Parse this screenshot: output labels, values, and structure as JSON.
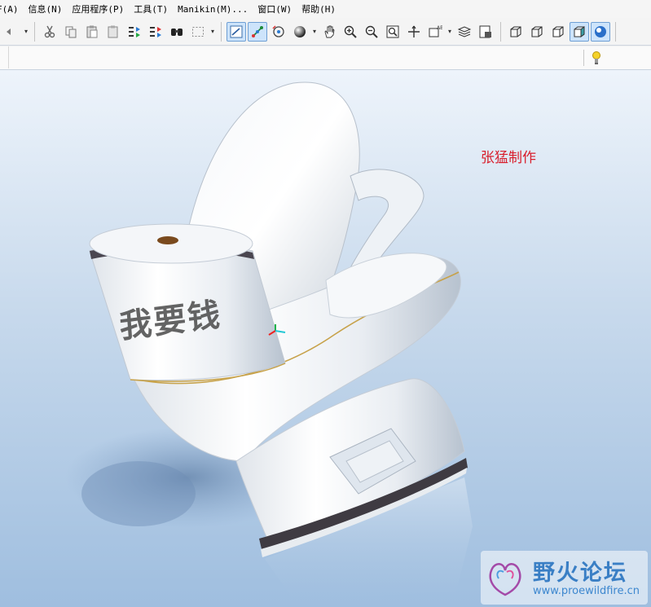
{
  "menubar": {
    "items": [
      "F(A)",
      "信息(N)",
      "应用程序(P)",
      "工具(T)",
      "Manikin(M)...",
      "窗口(W)",
      "帮助(H)"
    ]
  },
  "toolbar": {
    "icons": [
      "undo-icon",
      "cut-icon",
      "copy-icon",
      "paste-icon",
      "paste-special-icon",
      "regenerate-icon",
      "regenerate-manager-icon",
      "find-icon",
      "select-box-icon",
      "repaint-icon",
      "spin-center-icon",
      "orient-mode-icon",
      "render-style-icon",
      "pan-icon",
      "zoom-in-icon",
      "zoom-out-icon",
      "refit-icon",
      "reorient-icon",
      "saved-views-icon",
      "layers-icon",
      "view-manager-icon",
      "wireframe-icon",
      "hidden-line-icon",
      "no-hidden-icon",
      "shading-icon",
      "enhanced-realism-icon"
    ],
    "active": [
      "repaint-icon",
      "spin-center-icon",
      "shading-icon",
      "enhanced-realism-icon"
    ]
  },
  "viewport": {
    "signature": "张猛制作",
    "tank_text": "我要钱"
  },
  "watermark": {
    "title": "野火论坛",
    "url": "www.proewildfire.cn"
  },
  "colors": {
    "signature": "#d81e2c",
    "watermark_title": "#3a7fc5",
    "viewport_top": "#eef4fb",
    "viewport_bottom": "#9fbedf"
  }
}
